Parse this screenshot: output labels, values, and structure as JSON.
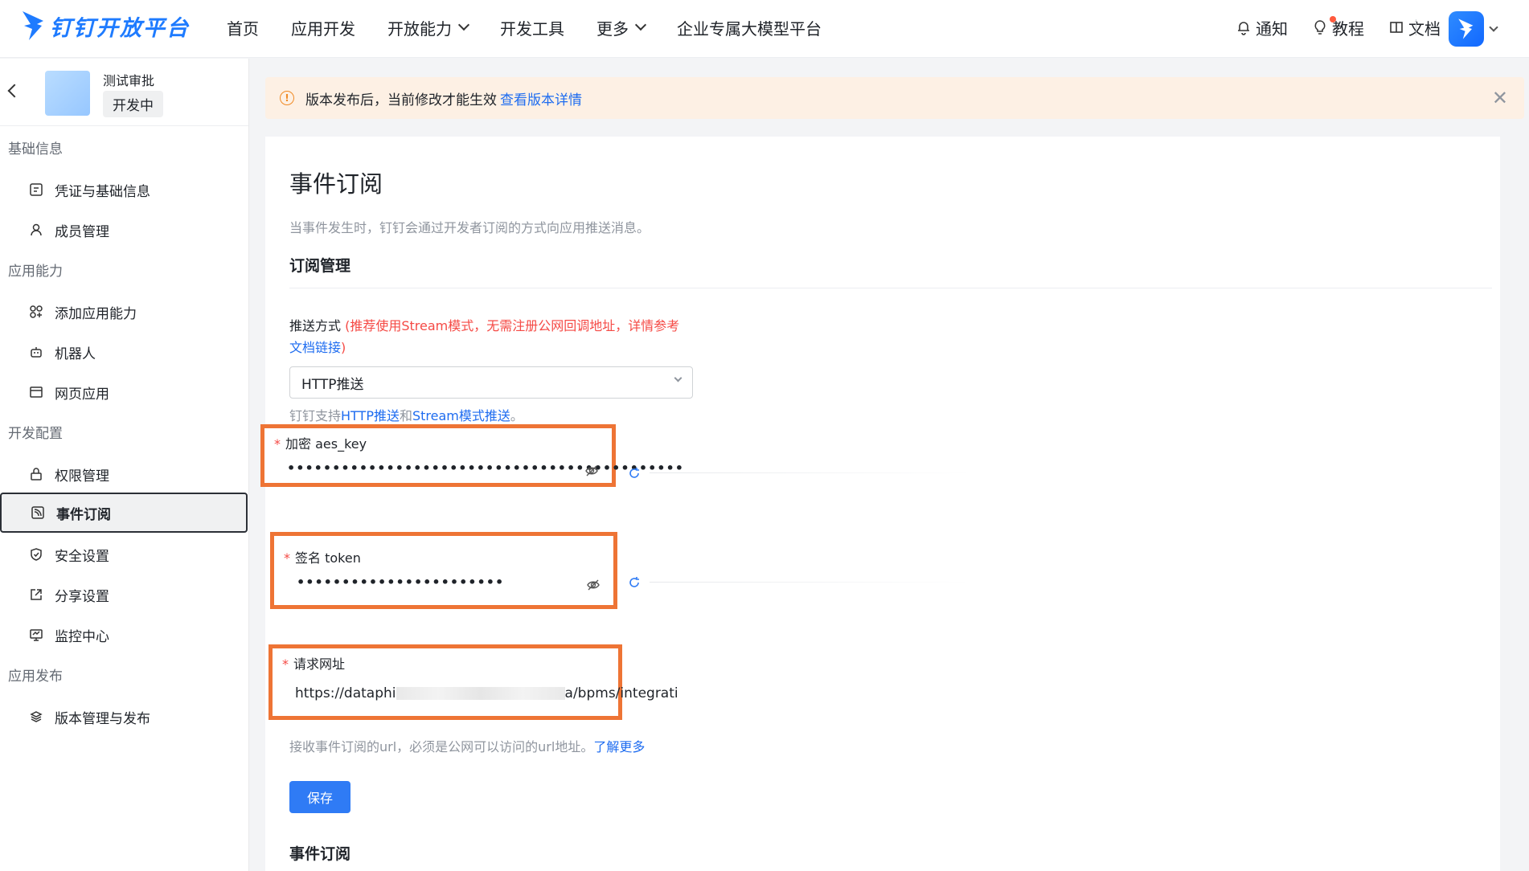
{
  "header": {
    "logo_text": "钉钉开放平台",
    "nav": [
      {
        "label": "首页",
        "dropdown": false
      },
      {
        "label": "应用开发",
        "dropdown": false
      },
      {
        "label": "开放能力",
        "dropdown": true
      },
      {
        "label": "开发工具",
        "dropdown": false
      },
      {
        "label": "更多",
        "dropdown": true
      },
      {
        "label": "企业专属大模型平台",
        "dropdown": false
      }
    ],
    "right": {
      "notify": "通知",
      "tutorial": "教程",
      "docs": "文档"
    }
  },
  "sidebar": {
    "app_name": "测试审批",
    "app_status": "开发中",
    "groups": [
      {
        "title": "基础信息"
      },
      {
        "title": "应用能力"
      },
      {
        "title": "开发配置"
      },
      {
        "title": "应用发布"
      }
    ],
    "items": [
      {
        "label": "凭证与基础信息",
        "icon": "credential-icon"
      },
      {
        "label": "成员管理",
        "icon": "user-icon"
      },
      {
        "label": "添加应用能力",
        "icon": "apps-grid-icon"
      },
      {
        "label": "机器人",
        "icon": "robot-icon"
      },
      {
        "label": "网页应用",
        "icon": "browser-icon"
      },
      {
        "label": "权限管理",
        "icon": "lock-icon"
      },
      {
        "label": "事件订阅",
        "icon": "feed-icon"
      },
      {
        "label": "安全设置",
        "icon": "shield-icon"
      },
      {
        "label": "分享设置",
        "icon": "share-icon"
      },
      {
        "label": "监控中心",
        "icon": "monitor-icon"
      },
      {
        "label": "版本管理与发布",
        "icon": "layers-icon"
      }
    ],
    "active": "事件订阅"
  },
  "banner": {
    "text": "版本发布后，当前修改才能生效",
    "link": "查看版本详情"
  },
  "main": {
    "title": "事件订阅",
    "description": "当事件发生时，钉钉会通过开发者订阅的方式向应用推送消息。",
    "section_title": "订阅管理",
    "push_label": "推送方式",
    "push_hint_open": "(",
    "push_hint_red": "推荐使用Stream模式，无需注册公网回调地址，详情参考",
    "push_hint_link": "文档链接",
    "push_hint_close": ")",
    "push_select_value": "HTTP推送",
    "support_prefix": "钉钉支持",
    "support_http": "HTTP推送",
    "support_and": "和",
    "support_stream": "Stream模式推送",
    "support_suffix": "。",
    "aes_label": "加密 aes_key",
    "aes_value": "••••••••••••••••••••••••••••••••••••••••••••",
    "token_label": "签名 token",
    "token_value": "•••••••••••••••••••••••",
    "url_label": "请求网址",
    "url_prefix": "https://dataphi",
    "url_suffix": "a/bpms/integrati",
    "url_tip": "接收事件订阅的url，必须是公网可以访问的url地址。",
    "url_tip_link": "了解更多",
    "save_label": "保存",
    "section2_title": "事件订阅"
  },
  "colors": {
    "accent": "#2f7bf5",
    "highlight_box": "#ee7435",
    "banner_bg": "#fdf0e4",
    "required": "#f54a45"
  }
}
